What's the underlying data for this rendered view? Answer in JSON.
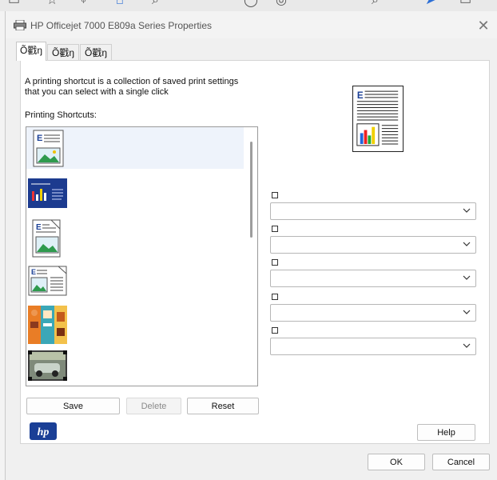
{
  "window": {
    "title": "HP Officejet 7000 E809a Series Properties",
    "close_glyph": "✕"
  },
  "tabs": [
    {
      "label": "Õ戵ŋ",
      "active": true
    },
    {
      "label": "Õ戵ŋ",
      "active": false
    },
    {
      "label": "Õ戵ŋ",
      "active": false
    }
  ],
  "description": {
    "line1": "A printing shortcut is a collection of saved print settings",
    "line2": "that you can select with a single click"
  },
  "shortcuts": {
    "label": "Printing Shortcuts:",
    "items": [
      {
        "icon": "document-with-picture-icon",
        "selected": true
      },
      {
        "icon": "photo-poster-icon",
        "selected": false
      },
      {
        "icon": "folded-document-icon",
        "selected": false
      },
      {
        "icon": "landscape-document-icon",
        "selected": false
      },
      {
        "icon": "brochure-icon",
        "selected": false
      },
      {
        "icon": "photo-car-icon",
        "selected": false
      }
    ]
  },
  "buttons": {
    "save": "Save",
    "delete": "Delete",
    "reset": "Reset",
    "help": "Help",
    "ok": "OK",
    "cancel": "Cancel"
  },
  "settings": [
    {
      "label": "",
      "value": ""
    },
    {
      "label": "",
      "value": ""
    },
    {
      "label": "",
      "value": ""
    },
    {
      "label": "",
      "value": ""
    },
    {
      "label": "",
      "value": ""
    }
  ],
  "colors": {
    "accent": "#1a3f96",
    "selection": "#eef3fb"
  },
  "logo": {
    "text": "hp"
  }
}
